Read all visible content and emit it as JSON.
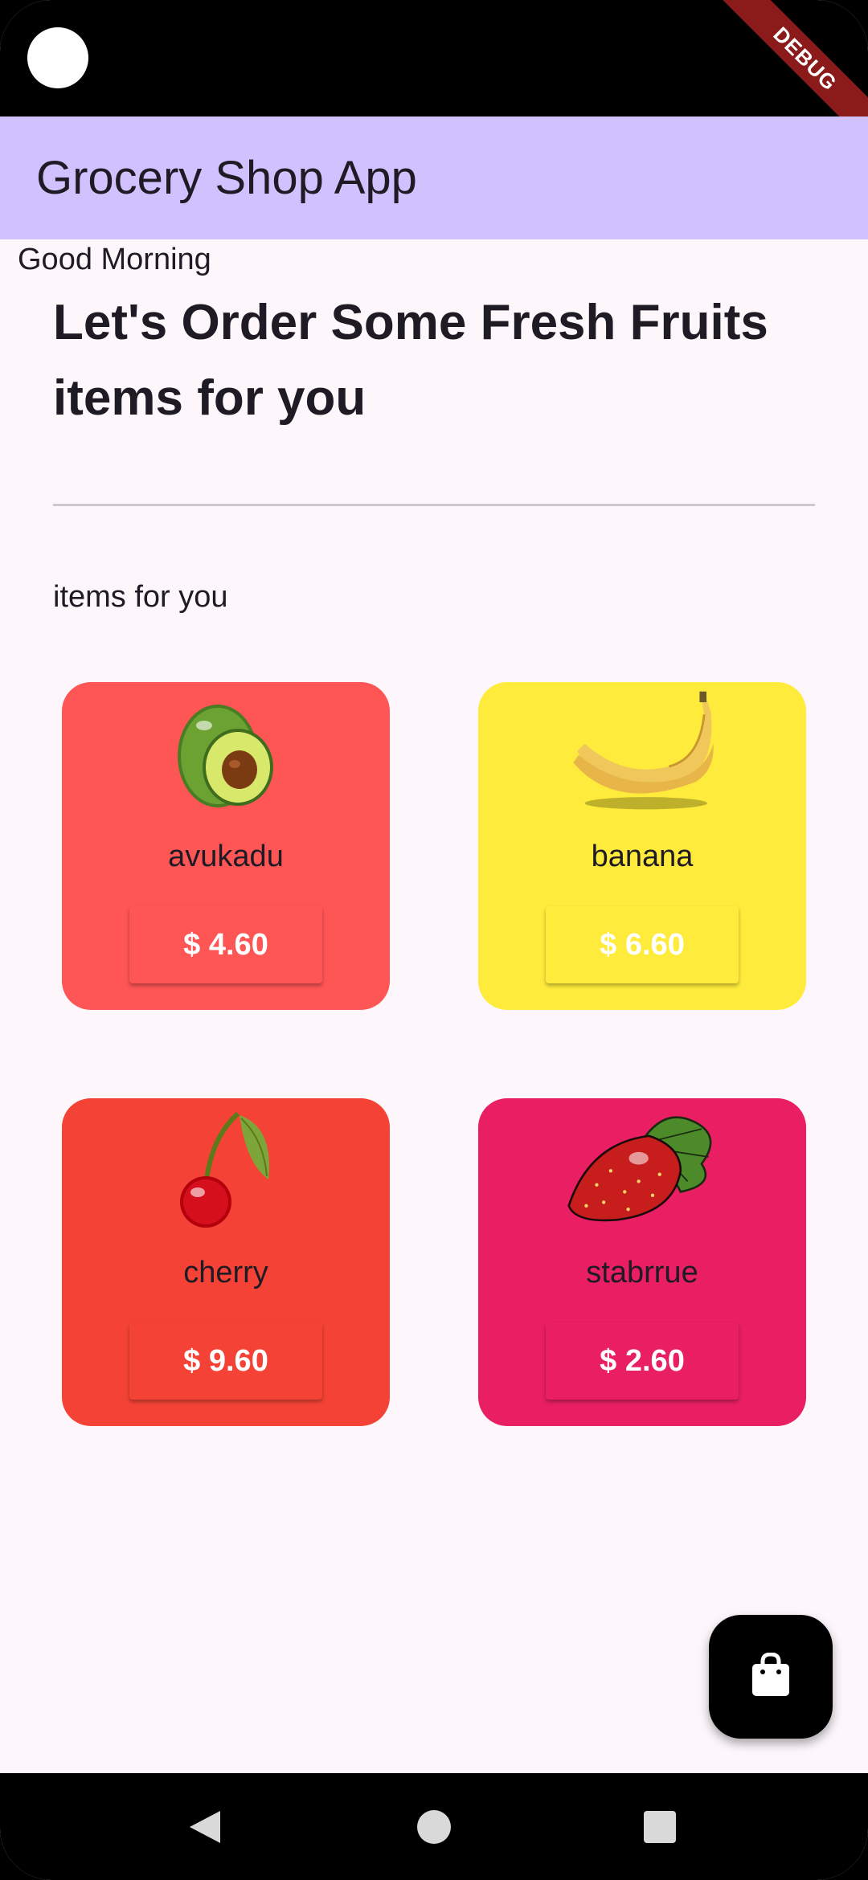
{
  "status_bar": {
    "debug_label": "DEBUG"
  },
  "app_bar": {
    "title": "Grocery Shop App",
    "color": "#d1c1fe"
  },
  "greeting": "Good Morning",
  "headline": "Let's Order Some Fresh Fruits items for you",
  "section_label": "items for you",
  "items": [
    {
      "name": "avukadu",
      "price": "$ 4.60",
      "color": "#fe5555",
      "icon": "avocado-icon"
    },
    {
      "name": "banana",
      "price": "$ 6.60",
      "color": "#ffeb3b",
      "icon": "banana-icon"
    },
    {
      "name": "cherry",
      "price": "$ 9.60",
      "color": "#f44336",
      "icon": "cherry-icon"
    },
    {
      "name": "stabrrue",
      "price": "$ 2.60",
      "color": "#e91e63",
      "icon": "strawberry-icon"
    }
  ],
  "fab": {
    "icon": "shopping-bag-icon"
  },
  "nav_bar": {
    "icons": [
      "back-icon",
      "home-icon",
      "recents-icon"
    ]
  }
}
